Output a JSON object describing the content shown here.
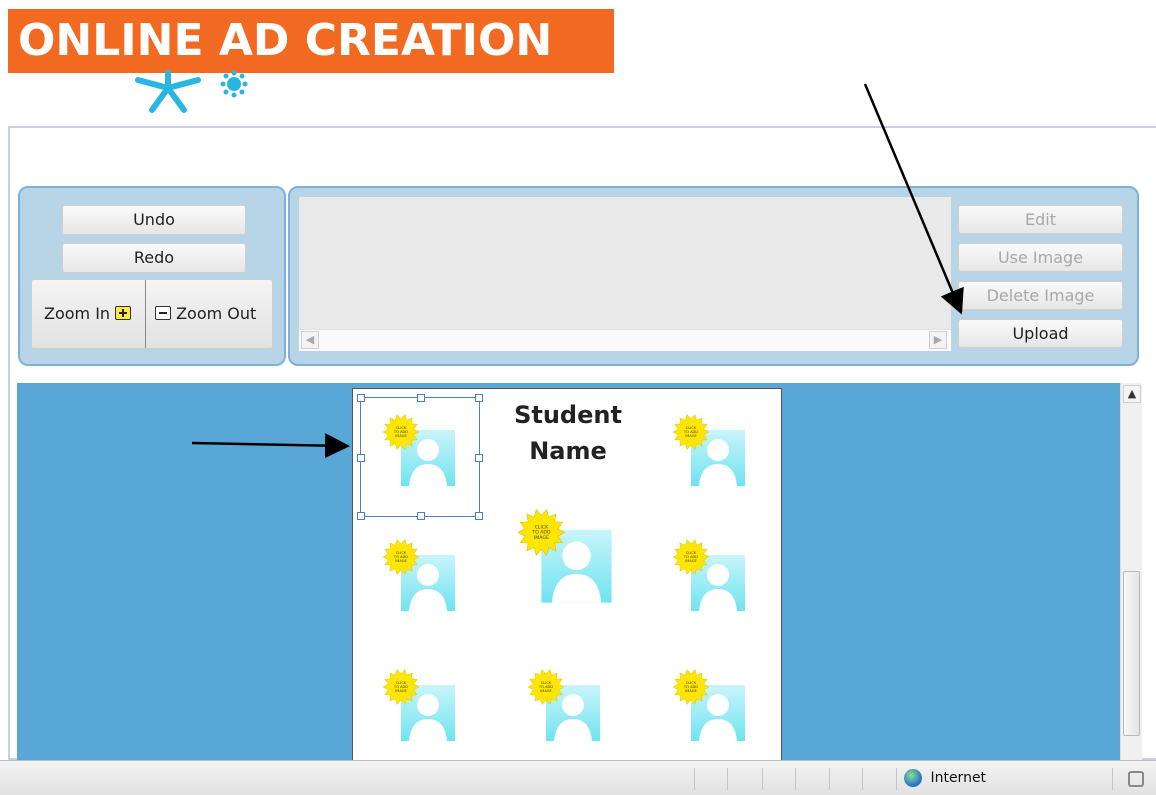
{
  "banner": {
    "title": "ONLINE AD CREATION",
    "bg_color": "#f26a21"
  },
  "toolbar": {
    "undo": "Undo",
    "redo": "Redo",
    "zoom_in": "Zoom In",
    "zoom_out": "Zoom Out"
  },
  "image_panel": {
    "edit": "Edit",
    "use_image": "Use Image",
    "delete_image": "Delete Image",
    "upload": "Upload"
  },
  "page": {
    "heading_line1": "Student",
    "heading_line2": "Name",
    "placeholder_badge": "CLICK TO ADD IMAGE"
  },
  "statusbar": {
    "zone": "Internet"
  },
  "colors": {
    "canvas": "#58a7d6",
    "panel": "#b8d5e8",
    "badge": "#ffe600",
    "silhouette_bg": "#7fe6f0"
  }
}
